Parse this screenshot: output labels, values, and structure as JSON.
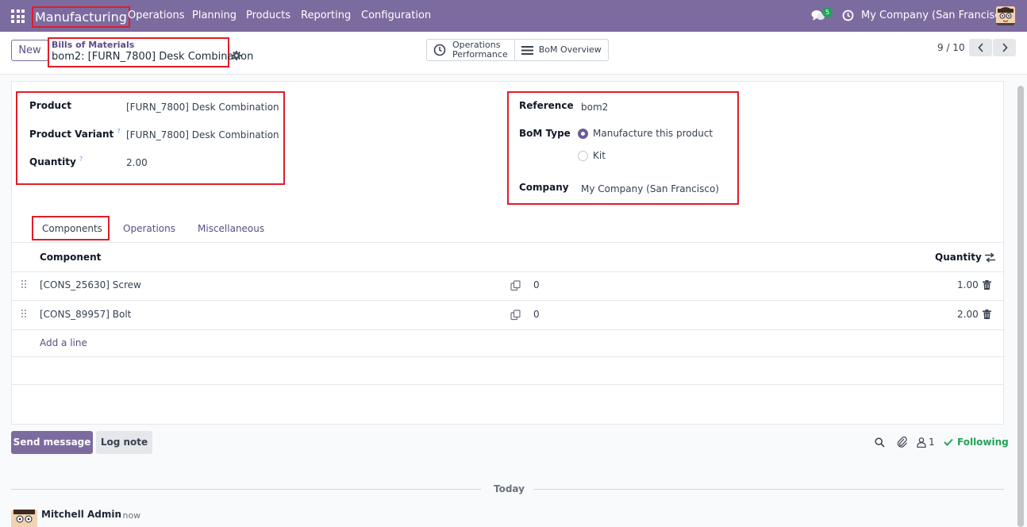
{
  "navbar": {
    "app_name": "Manufacturing",
    "menu": [
      "Operations",
      "Planning",
      "Products",
      "Reporting",
      "Configuration"
    ],
    "chat_badge": "5",
    "company": "My Company (San Francisco)"
  },
  "control_panel": {
    "new_label": "New",
    "breadcrumb_parent": "Bills of Materials",
    "breadcrumb_current": "bom2: [FURN_7800] Desk Combination",
    "stat_operations_line1": "Operations",
    "stat_operations_line2": "Performance",
    "stat_bom_overview": "BoM Overview",
    "pager": "9 / 10"
  },
  "form": {
    "product_label": "Product",
    "product_value": "[FURN_7800] Desk Combination",
    "variant_label": "Product Variant",
    "variant_value": "[FURN_7800] Desk Combination",
    "quantity_label": "Quantity",
    "quantity_value": "2.00",
    "help_mark": "?",
    "reference_label": "Reference",
    "reference_value": "bom2",
    "bom_type_label": "BoM Type",
    "bom_type_options": [
      "Manufacture this product",
      "Kit"
    ],
    "bom_type_selected": "Manufacture this product",
    "company_label": "Company",
    "company_value": "My Company (San Francisco)"
  },
  "tabs": [
    "Components",
    "Operations",
    "Miscellaneous"
  ],
  "components": {
    "col_component": "Component",
    "col_quantity": "Quantity",
    "rows": [
      {
        "component": "[CONS_25630] Screw",
        "mid": "0",
        "quantity": "1.00"
      },
      {
        "component": "[CONS_89957] Bolt",
        "mid": "0",
        "quantity": "2.00"
      }
    ],
    "add_line": "Add a line"
  },
  "chatter": {
    "send_message": "Send message",
    "log_note": "Log note",
    "followers_count": "1",
    "following": "Following",
    "day_label": "Today",
    "author": "Mitchell Admin",
    "time": "- now"
  },
  "colors": {
    "brand": "#7c6b9f",
    "highlight": "#e11d2a",
    "success": "#22a35a"
  }
}
